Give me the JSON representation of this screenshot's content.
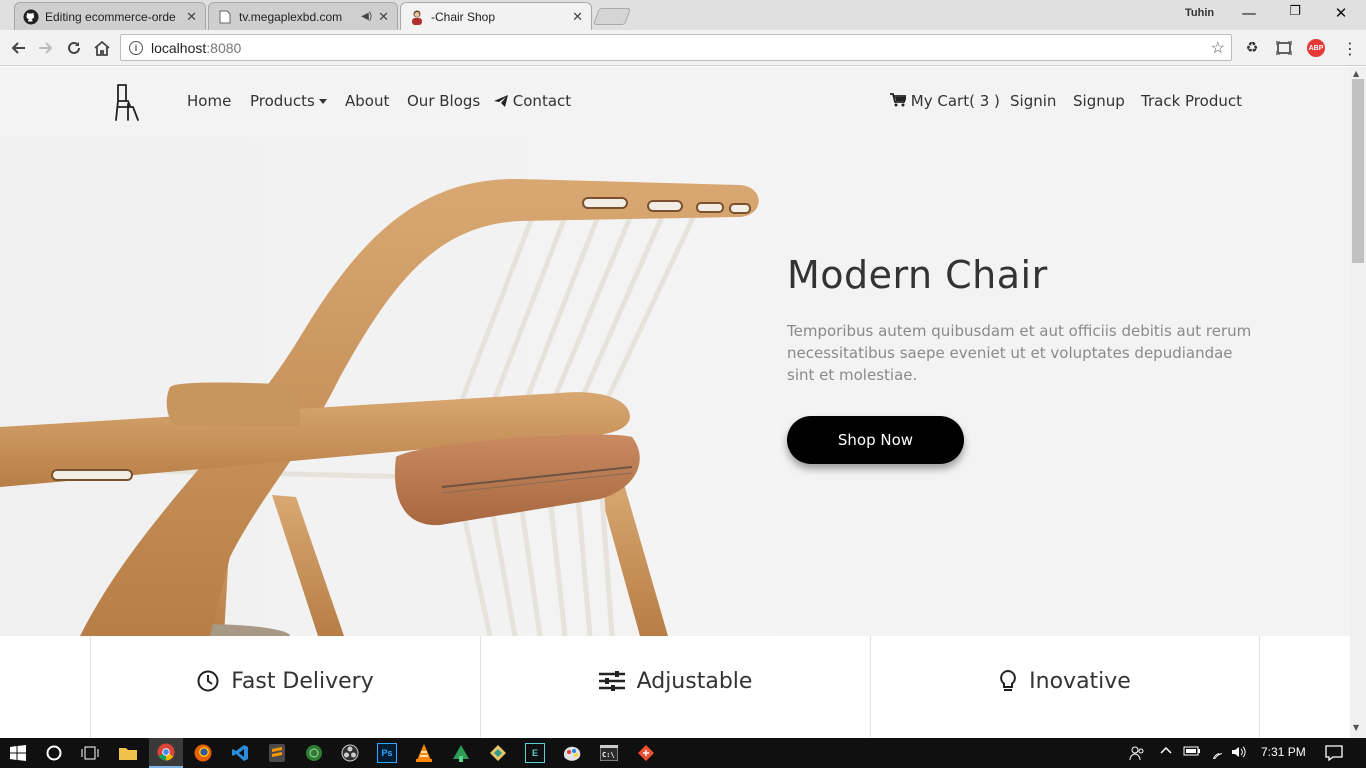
{
  "browser": {
    "tabs": [
      {
        "title": "Editing ecommerce-orde",
        "icon": "github-icon"
      },
      {
        "title": "tv.megaplexbd.com",
        "icon": "page-icon",
        "audio": "speaker-icon"
      },
      {
        "title": "-Chair Shop",
        "icon": "avatar-icon",
        "active": true
      }
    ],
    "profile": "Tuhin",
    "url_host": "localhost",
    "url_port": ":8080"
  },
  "nav": {
    "home": "Home",
    "products": "Products",
    "about": "About",
    "blogs": "Our Blogs",
    "contact": "Contact",
    "cart": "My Cart( 3 )",
    "signin": "Signin",
    "signup": "Signup",
    "track": "Track Product"
  },
  "hero": {
    "title": "Modern Chair",
    "text": "Temporibus autem quibusdam et aut officiis debitis aut rerum necessitatibus saepe eveniet ut et voluptates depudiandae sint et molestiae.",
    "button": "Shop Now"
  },
  "features": [
    {
      "label": "Fast Delivery",
      "icon": "clock-icon"
    },
    {
      "label": "Adjustable",
      "icon": "sliders-icon"
    },
    {
      "label": "Inovative",
      "icon": "lightbulb-icon"
    }
  ],
  "taskbar": {
    "time": "7:31 PM"
  },
  "colors": {
    "page_bg": "#f3f3f3",
    "wood": "#c9955e",
    "leather": "#b9764f",
    "button": "#000000"
  }
}
